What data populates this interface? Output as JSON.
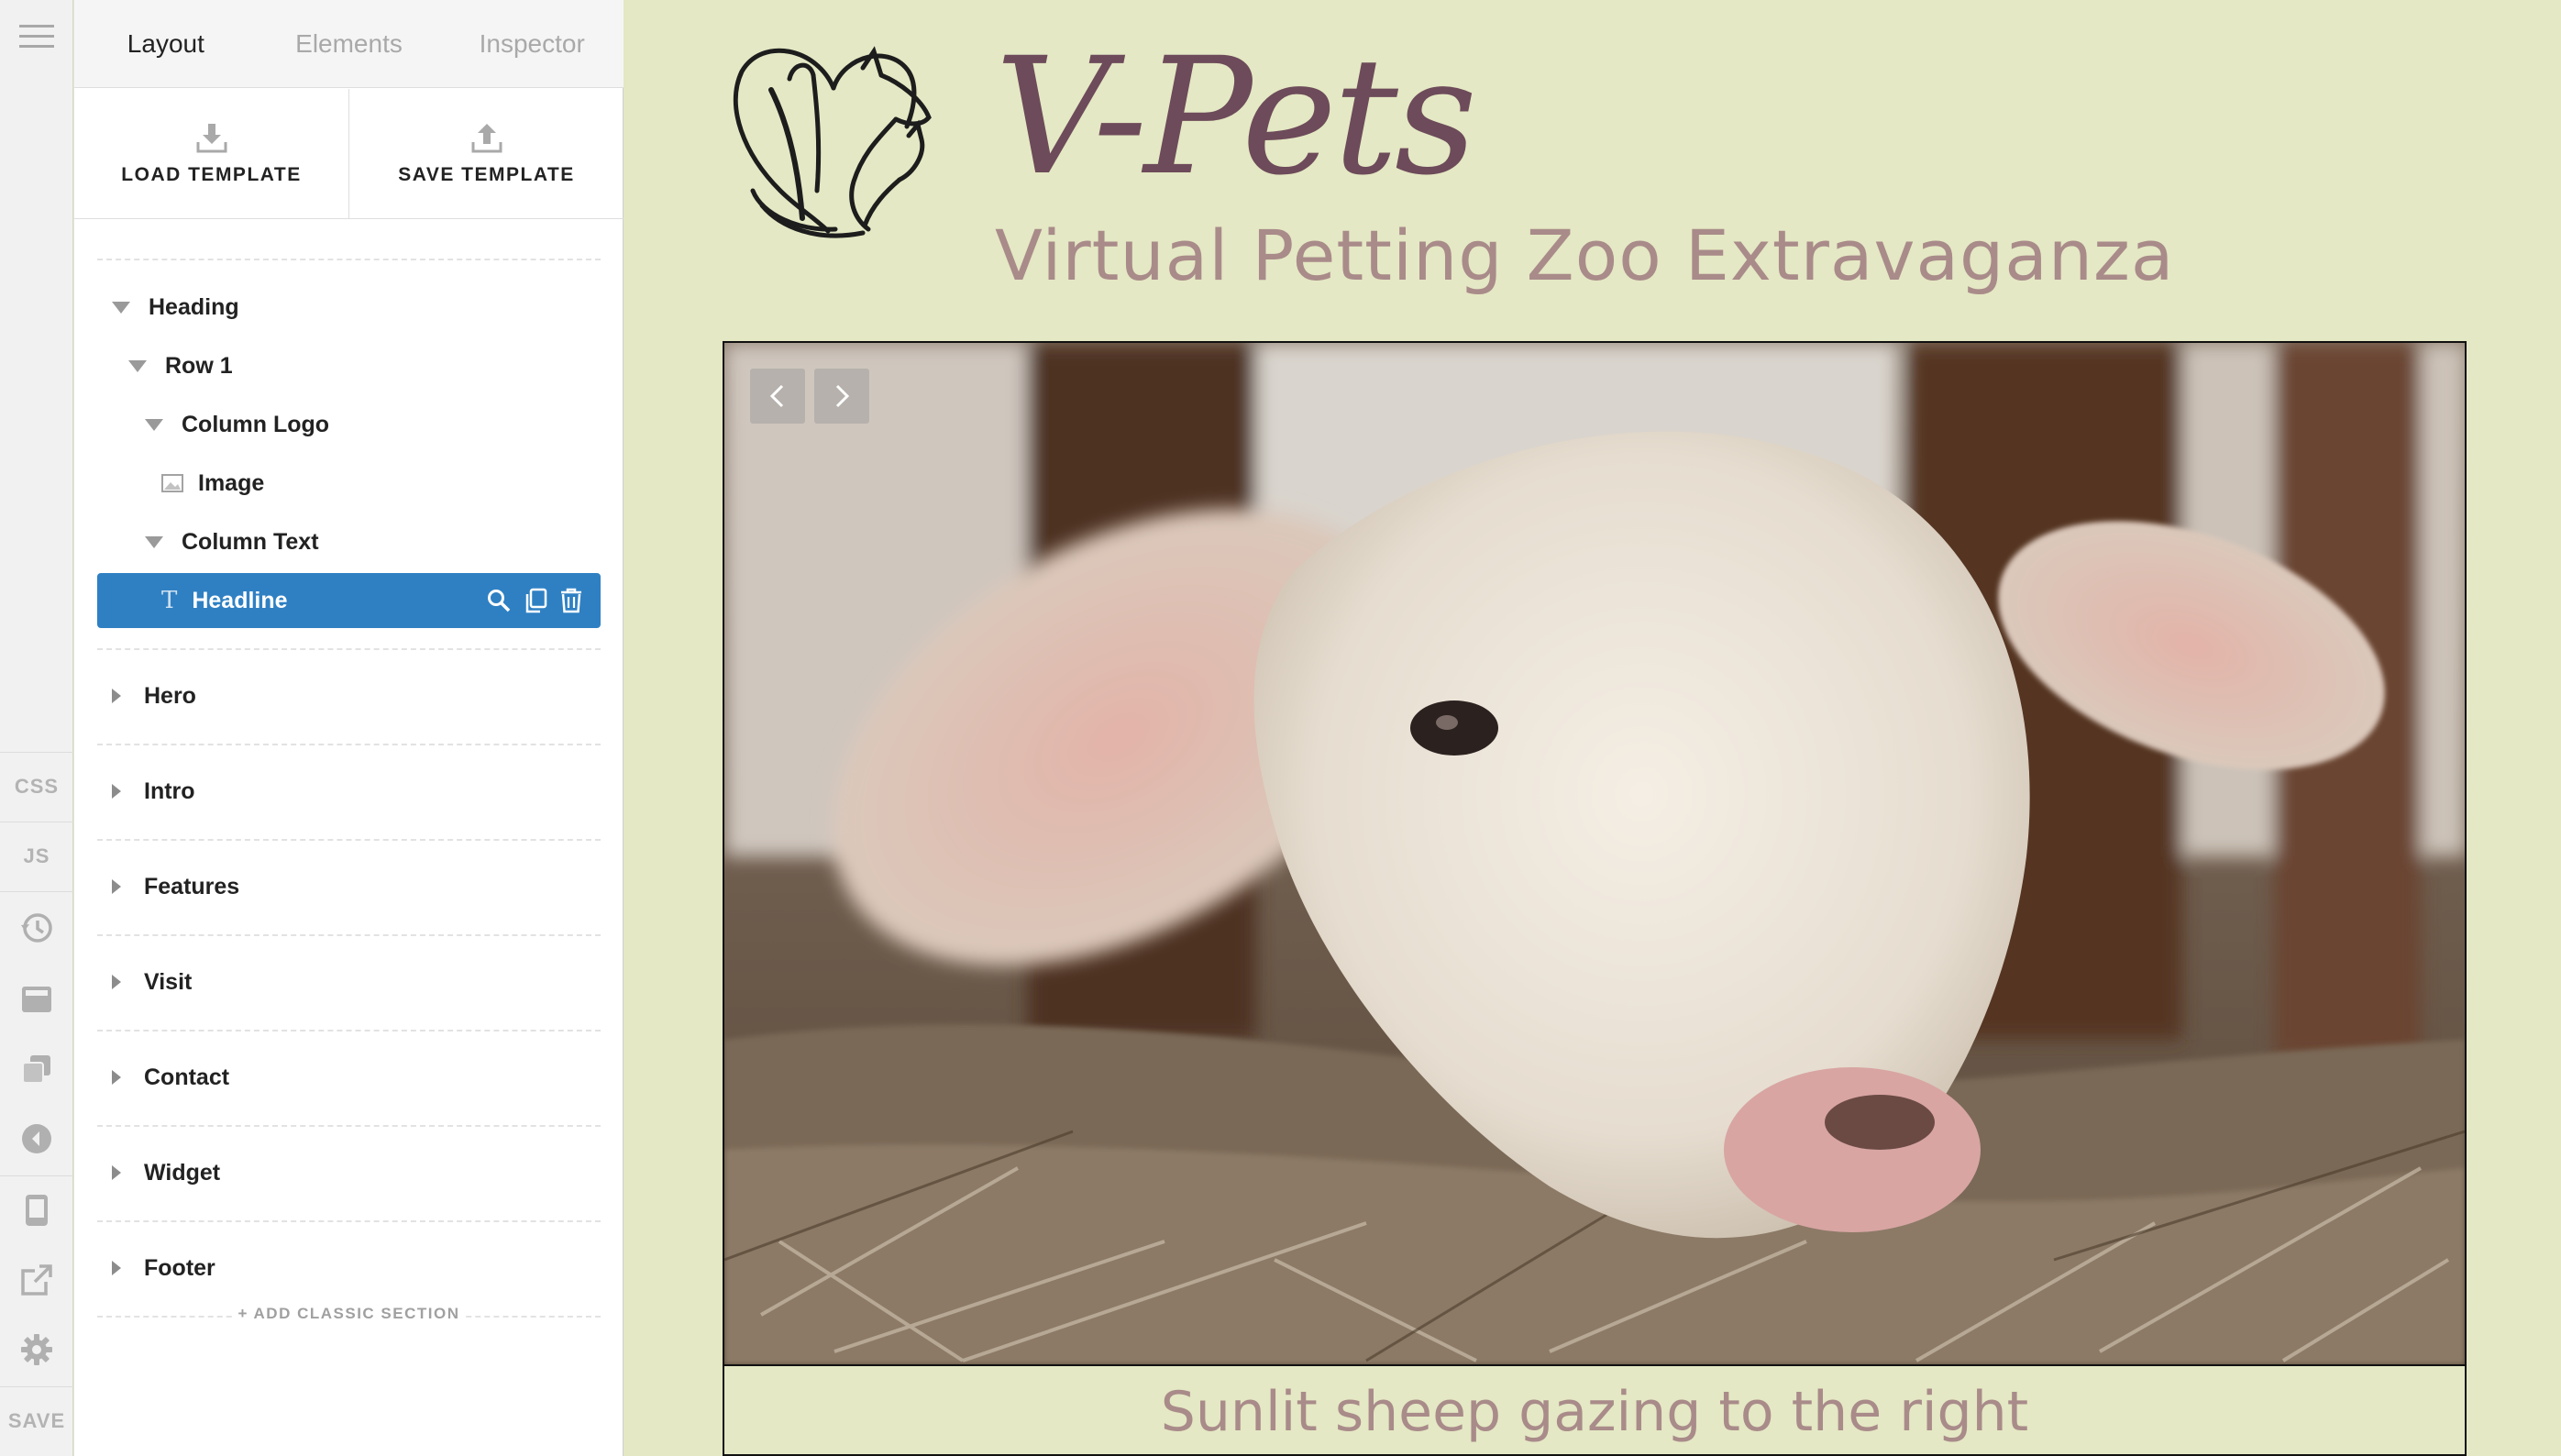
{
  "rail": {
    "css_label": "CSS",
    "js_label": "JS",
    "save_label": "SAVE"
  },
  "panel": {
    "tabs": [
      {
        "label": "Layout",
        "active": true
      },
      {
        "label": "Elements",
        "active": false
      },
      {
        "label": "Inspector",
        "active": false
      }
    ],
    "load_template": "LOAD TEMPLATE",
    "save_template": "SAVE TEMPLATE",
    "tree": {
      "heading": "Heading",
      "row1": "Row 1",
      "column_logo": "Column Logo",
      "image": "Image",
      "column_text": "Column Text",
      "headline": "Headline",
      "sections": [
        "Hero",
        "Intro",
        "Features",
        "Visit",
        "Contact",
        "Widget",
        "Footer"
      ]
    },
    "add_classic": "+ ADD CLASSIC SECTION"
  },
  "site": {
    "brand": "V-Pets",
    "tagline": "Virtual Petting Zoo Extravaganza",
    "caption": "Sunlit sheep gazing to the right"
  },
  "colors": {
    "canvas_bg": "#e4e8c4",
    "selected": "#2f80c3",
    "brand": "#6d4b5a",
    "tagline": "#a98b8a"
  }
}
